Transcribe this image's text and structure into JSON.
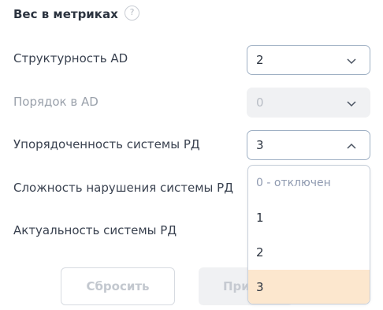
{
  "section": {
    "title": "Вес в метриках",
    "help_icon": "question-circle-icon",
    "help_glyph": "?"
  },
  "rows": [
    {
      "label": "Структурность AD",
      "value": "2",
      "disabled": false,
      "expanded": false
    },
    {
      "label": "Порядок в AD",
      "value": "0",
      "disabled": true,
      "expanded": false
    },
    {
      "label": "Упорядоченность системы РД",
      "value": "3",
      "disabled": false,
      "expanded": true
    },
    {
      "label": "Сложность нарушения системы РД"
    },
    {
      "label": "Актуальность системы РД"
    }
  ],
  "dropdown": {
    "options": [
      "0 - отключен",
      "1",
      "2",
      "3"
    ],
    "selected": "3",
    "highlight_color": "#fce7ce"
  },
  "buttons": {
    "reset": "Сбросить",
    "apply": "При"
  },
  "colors": {
    "select_border": "#9fb0c4",
    "disabled_bg": "#f0f1f3",
    "text": "#2c3440"
  }
}
